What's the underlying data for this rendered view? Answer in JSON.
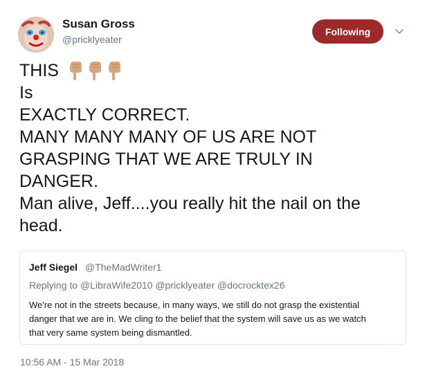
{
  "author": {
    "name": "Susan Gross",
    "handle": "@pricklyeater",
    "avatar_icon": "clown-face-avatar"
  },
  "follow_button": {
    "label": "Following",
    "color": "#9c2a2a"
  },
  "menu_icon": "chevron-down-icon",
  "tweet": {
    "lines": [
      "THIS",
      "Is",
      "EXACTLY CORRECT.",
      "MANY MANY MANY OF US ARE NOT",
      "GRASPING THAT WE ARE TRULY IN",
      "DANGER.",
      "Man alive, Jeff....you really hit the nail on the",
      "head."
    ],
    "emoji": [
      "backhand-index-pointing-down",
      "backhand-index-pointing-down",
      "backhand-index-pointing-down"
    ]
  },
  "quoted_tweet": {
    "name": "Jeff Siegel",
    "handle": "@TheMadWriter1",
    "replying_prefix": "Replying to",
    "mentions": [
      "@LibraWife2010",
      "@pricklyeater",
      "@docrocktex26"
    ],
    "body_lines": [
      "We're not in the streets because, in many ways, we still do not grasp the existential",
      "danger that we are in. We cling to the belief that the system will save us as we watch",
      "that very same system being dismantled."
    ]
  },
  "timestamp": "10:56 AM - 15 Mar 2018"
}
